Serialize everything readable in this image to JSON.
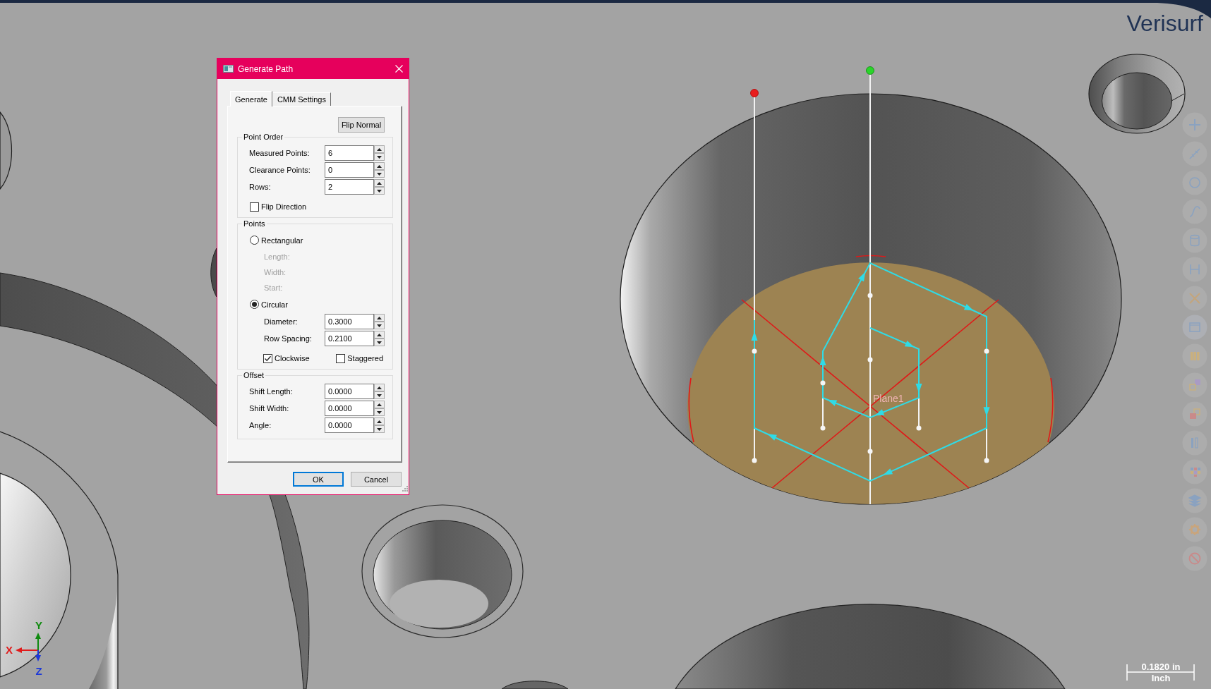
{
  "viewport": {
    "logo": "Verisurf",
    "plane_label": "Plane1",
    "axes": [
      {
        "kind": "x",
        "label": "X"
      },
      {
        "kind": "y",
        "label": "Y"
      },
      {
        "kind": "z",
        "label": "Z"
      }
    ],
    "scale_bar": {
      "value": "0.1820 in",
      "unit": "Inch"
    }
  },
  "dialog": {
    "title": "Generate Path",
    "tabs": [
      {
        "label": "Generate",
        "selected": true
      },
      {
        "label": "CMM Settings",
        "selected": false
      }
    ],
    "flip_normal_button": "Flip Normal",
    "groups": [
      {
        "title": "Point Order",
        "rows": [
          {
            "kind": "spin",
            "label": "Measured Points:",
            "value": "6"
          },
          {
            "kind": "spin",
            "label": "Clearance Points:",
            "value": "0"
          },
          {
            "kind": "spin",
            "label": "Rows:",
            "value": "2"
          },
          {
            "kind": "checks",
            "items": [
              {
                "label": "Flip Direction",
                "checked": false
              }
            ]
          }
        ]
      },
      {
        "title": "Points",
        "rows": [
          {
            "kind": "radio",
            "label": "Rectangular",
            "selected": false,
            "children": [
              {
                "kind": "caption",
                "label": "Length:",
                "disabled": true
              },
              {
                "kind": "caption",
                "label": "Width:",
                "disabled": true
              },
              {
                "kind": "caption",
                "label": "Start:",
                "disabled": true
              }
            ]
          },
          {
            "kind": "radio",
            "label": "Circular",
            "selected": true,
            "children": [
              {
                "kind": "spin",
                "label": "Diameter:",
                "value": "0.3000",
                "disabled": false
              },
              {
                "kind": "spin",
                "label": "Row Spacing:",
                "value": "0.2100",
                "disabled": false
              },
              {
                "kind": "checks",
                "disabled": false,
                "items": [
                  {
                    "label": "Clockwise",
                    "checked": true
                  },
                  {
                    "label": "Staggered",
                    "checked": false
                  }
                ]
              }
            ]
          }
        ]
      },
      {
        "title": "Offset",
        "rows": [
          {
            "kind": "spin",
            "label": "Shift Length:",
            "value": "0.0000"
          },
          {
            "kind": "spin",
            "label": "Shift Width:",
            "value": "0.0000"
          },
          {
            "kind": "spin",
            "label": "Angle:",
            "value": "0.0000"
          }
        ]
      }
    ],
    "buttons": [
      {
        "label": "OK",
        "default": true
      },
      {
        "label": "Cancel",
        "default": false
      }
    ]
  }
}
